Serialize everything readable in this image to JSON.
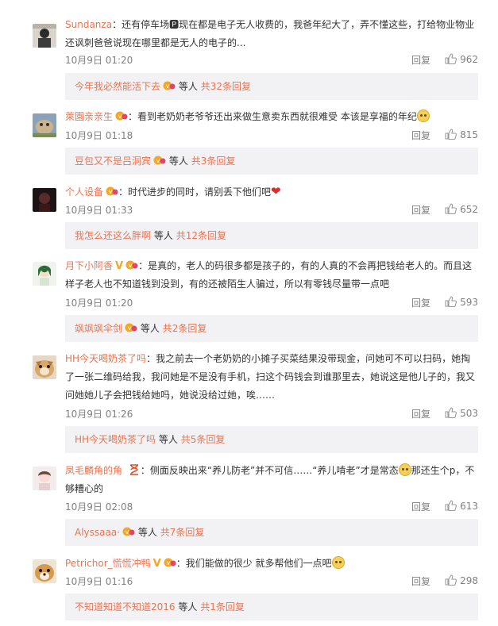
{
  "labels": {
    "reply": "回复",
    "etc": "等人"
  },
  "comments": [
    {
      "user": "Sundanza",
      "text": "：还有停车场🅿现在都是电子无人收费的，我爸年纪大了，弄不懂这些，打给物业物业还讽刺爸爸说现在哪里都是无人的电子的...",
      "time": "10月9日 01:20",
      "likes": "962",
      "sub_user": "今年我必然能活下去",
      "sub_total": "共32条回复"
    },
    {
      "user": "萊園亲亲生",
      "text": "：看到老奶奶老爷爷还出来做生意卖东西就很难受 本该是享福的年纪",
      "time": "10月9日 01:18",
      "likes": "815",
      "sub_user": "豆包又不是吕洞宾",
      "sub_total": "共3条回复"
    },
    {
      "user": "个人设备",
      "text": "：时代进步的同时，请别丢下他们吧",
      "time": "10月9日 01:33",
      "likes": "652",
      "sub_user": "我怎么还这么胖啊",
      "sub_total": "共12条回复"
    },
    {
      "user": "月下小阿香",
      "text": "：是真的，老人的码很多都是孩子的，有的人真的不会再把钱给老人的。而且这样子老人也不知道钱到没到，有的还被陌生人骗过，所以有零钱尽量带一点吧",
      "time": "10月9日 01:20",
      "likes": "593",
      "sub_user": "飒飒飒伞剑",
      "sub_total": "共2条回复"
    },
    {
      "user": "HH今天喝奶茶了吗",
      "text": "：我之前去一个老奶奶的小摊子买菜结果没带现金，问她可不可以扫码，她掏了一张二维码给我，我问她是不是没有手机，扫这个码钱会到谁那里去，她说这是他儿子的，我又问她她儿子会把钱给她吗，她说没给过她，唉……",
      "time": "10月9日 01:26",
      "likes": "503",
      "sub_user": "HH今天喝奶茶了吗",
      "sub_total": "共5条回复"
    },
    {
      "user": "凤毛麟角的角",
      "text_a": "：侧面反映出来“养儿防老”并不可信……“养儿啃老”才是常态",
      "text_b": "那还生个p，不够糟心的",
      "time": "10月9日 02:08",
      "likes": "613",
      "sub_user": "Alyssaaa·",
      "sub_total": "共7条回复"
    },
    {
      "user": "Petrichor_慌慌冲鸭",
      "text": "：我们能做的很少 就多帮他们一点吧",
      "time": "10月9日 01:16",
      "likes": "298",
      "sub_user": "不知道知道不知道2016",
      "sub_total": "共1条回复"
    }
  ]
}
